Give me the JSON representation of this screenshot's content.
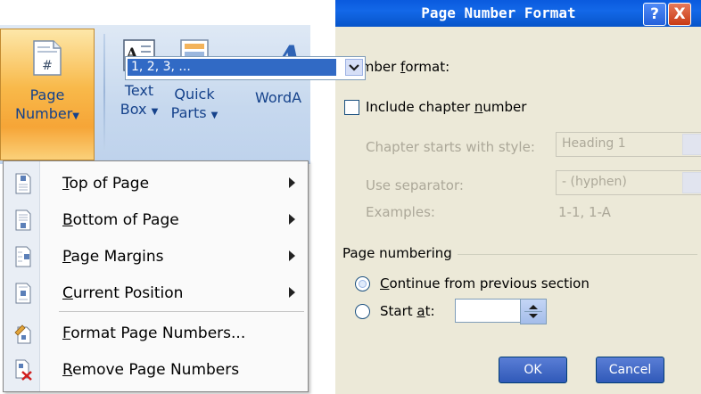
{
  "ribbon": {
    "page_number": {
      "line1": "Page",
      "line2": "Number"
    },
    "text_box": {
      "line1": "Text",
      "line2": "Box"
    },
    "quick_parts": {
      "line1": "Quick",
      "line2": "Parts"
    },
    "wordart": {
      "label": "WordA"
    }
  },
  "menu": {
    "items": [
      {
        "label": "Top of Page",
        "icon": "page-top-number-icon",
        "submenu": true
      },
      {
        "label": "Bottom of Page",
        "icon": "page-bottom-number-icon",
        "submenu": true
      },
      {
        "label": "Page Margins",
        "icon": "page-margin-number-icon",
        "submenu": true
      },
      {
        "label": "Current Position",
        "icon": "page-current-number-icon",
        "submenu": true
      },
      {
        "label": "Format Page Numbers...",
        "icon": "format-page-numbers-icon",
        "submenu": false
      },
      {
        "label": "Remove Page Numbers",
        "icon": "remove-page-numbers-icon",
        "submenu": false
      }
    ]
  },
  "dialog": {
    "title": "Page Number Format",
    "help_button": "?",
    "close_button": "X",
    "number_format_label": "Number format:",
    "number_format_value": "1, 2, 3, ...",
    "include_chapter_label": "Include chapter number",
    "include_chapter_checked": false,
    "chapter_style_label": "Chapter starts with style:",
    "chapter_style_value": "Heading 1",
    "separator_label": "Use separator:",
    "separator_value": "-   (hyphen)",
    "examples_label": "Examples:",
    "examples_value": "1-1, 1-A",
    "page_numbering_label": "Page numbering",
    "continue_label": "Continue from previous section",
    "start_at_label": "Start at:",
    "start_at_value": "",
    "selected_option": "continue",
    "ok_label": "OK",
    "cancel_label": "Cancel"
  },
  "colors": {
    "title_bar": "#0a5ade",
    "selection": "#316ac5",
    "dialog_bg": "#ece9d8",
    "ribbon_text": "#15428b",
    "active_button": "#f8b94a"
  }
}
